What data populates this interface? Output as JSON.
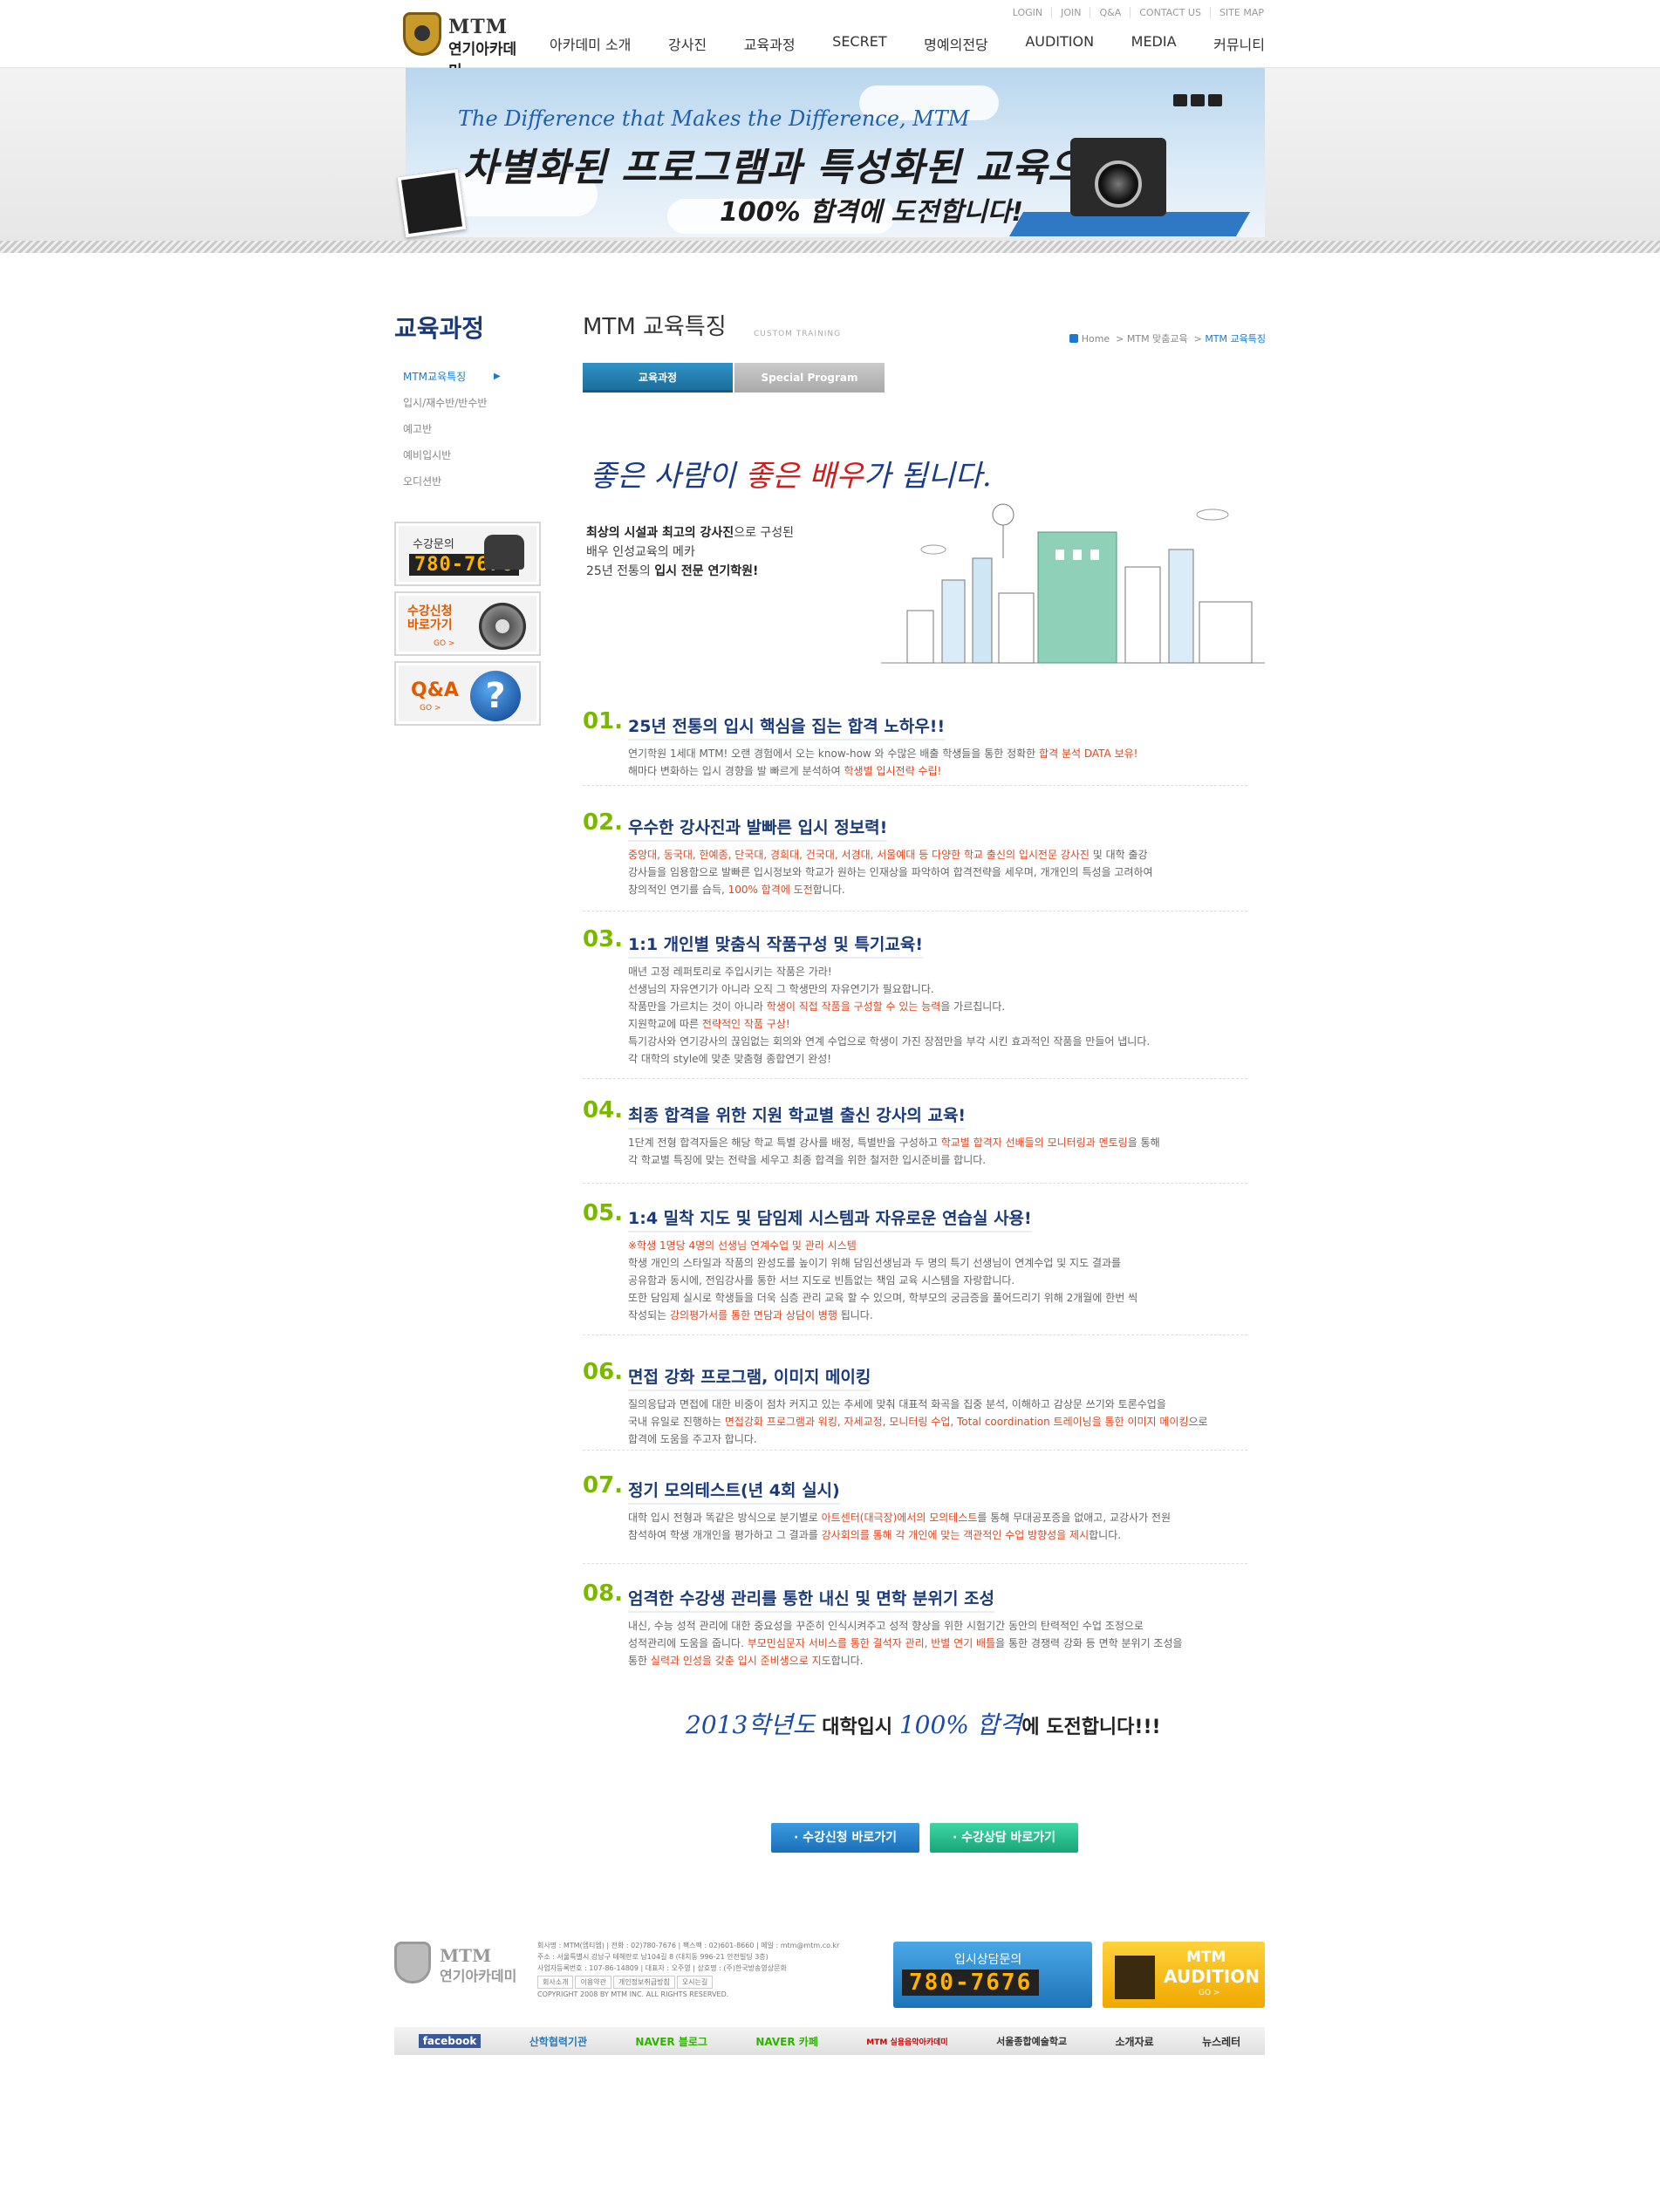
{
  "header": {
    "logo_en": "MTM",
    "logo_ko": "연기아카데미",
    "util_links": [
      "LOGIN",
      "JOIN",
      "Q&A",
      "CONTACT US",
      "SITE MAP"
    ],
    "nav": [
      "아카데미 소개",
      "강사진",
      "교육과정",
      "SECRET",
      "명예의전당",
      "AUDITION",
      "MEDIA",
      "커뮤니티"
    ]
  },
  "banner": {
    "en": "The Difference that Makes the Difference, MTM",
    "line1": "차별화된 프로그램과 특성화된 교육으로",
    "line2": "100% 합격에 도전합니다!"
  },
  "sidebar": {
    "title": "교육과정",
    "items": [
      {
        "label": "MTM교육특징",
        "active": true
      },
      {
        "label": "입시/재수반/반수반"
      },
      {
        "label": "예고반"
      },
      {
        "label": "예비입시반"
      },
      {
        "label": "오디션반"
      }
    ],
    "phone_label": "수강문의",
    "phone_number": "780-7676",
    "register_label": "수강신청 바로가기",
    "register_go": "GO >",
    "qna_label": "Q&A",
    "qna_go": "GO >"
  },
  "main": {
    "title": "MTM 교육특징",
    "subtitle": "CUSTOM TRAINING",
    "breadcrumb": [
      "Home",
      "MTM 맞춤교육",
      "MTM 교육특징"
    ],
    "tabs": [
      "교육과정",
      "Special Program"
    ],
    "slogan_a": "좋은 사람이 ",
    "slogan_b": "좋은 배우",
    "slogan_c": "가 됩니다.",
    "intro_1a": "최상의 시설과 최고의 강사진",
    "intro_1b": "으로 구성된",
    "intro_2": "배우 인성교육의 메카",
    "intro_3a": "25년 전통의 ",
    "intro_3b": "입시 전문 연기학원!",
    "sections": [
      {
        "num": "01.",
        "title": "25년 전통의 입시 핵심을 집는 합격 노하우!!",
        "lines": [
          [
            "연기학원 1세대 MTM! 오랜 경험에서 오는 know-how 와 수많은 배출 학생들을 통한 정확한 ",
            "합격 분석 DATA 보유!"
          ],
          [
            "해마다 변화하는 입시 경향을 발 빠르게 분석하여 ",
            "학생별 입시전략 수립!"
          ]
        ]
      },
      {
        "num": "02.",
        "title": "우수한 강사진과 발빠른 입시 정보력!",
        "lines": [
          [
            "",
            "중앙대, 동국대, 한예종, 단국대, 경희대, 건국대, 서경대, 서울예대 등 다양한 학교 출신의 입시전문 강사진",
            " 및 대학 출강"
          ],
          [
            "강사들을 임용함으로 발빠른 입시정보와 학교가 원하는 인재상을 파악하여 합격전략을 세우며, 개개인의 특성을 고려하여"
          ],
          [
            "창의적인 연기를 습득, ",
            "100% 합격에 도전",
            "합니다."
          ]
        ]
      },
      {
        "num": "03.",
        "title": "1:1 개인별 맞춤식 작품구성 및 특기교육!",
        "lines": [
          [
            "매년 고정 레퍼토리로 주입시키는 작품은 가라!"
          ],
          [
            "선생님의 자유연기가 아니라 오직 그 학생만의 자유연기가 필요합니다."
          ],
          [
            "작품만을 가르치는 것이 아니라 ",
            "학생이 직접 작품을 구성할 수 있는 능력",
            "을 가르칩니다."
          ],
          [
            "지원학교에 따른 ",
            "전략적인 작품 구상!"
          ],
          [
            "특기강사와 연기강사의 끊임없는 회의와 연계 수업으로 학생이 가진 장점만을 부각 시킨 효과적인 작품을 만들어 냅니다."
          ],
          [
            "각 대학의 style에 맞춘 맞춤형 종합연기 완성!"
          ]
        ]
      },
      {
        "num": "04.",
        "title": "최종 합격을 위한 지원 학교별 출신 강사의 교육!",
        "lines": [
          [
            "1단계 전형 합격자들은 해당 학교 특별 강사를 배정, 특별반을 구성하고 ",
            "학교별 합격자 선배들의 모니터링과 멘토링",
            "을 통해"
          ],
          [
            "각 학교별 특징에 맞는 전략을 세우고 최종 합격을 위한 철저한 입시준비를 합니다."
          ]
        ]
      },
      {
        "num": "05.",
        "title": "1:4 밀착 지도 및 담임제 시스템과 자유로운 연습실 사용!",
        "lines": [
          [
            "",
            "※학생 1명당 4명의 선생님 연계수업 및 관리 시스템"
          ],
          [
            "학생 개인의 스타일과 작품의 완성도를 높이기 위해 담임선생님과 두 명의 특기 선생님이 연계수업 및 지도 결과를"
          ],
          [
            "공유함과 동시에, 전임강사를 통한 서브 지도로 빈틈없는 책임 교육 시스템을 자랑합니다."
          ],
          [
            "또한 담임제 실시로 학생들을 더욱 심층 관리 교육 할 수 있으며, 학부모의 궁금증을 풀어드리기 위해 2개월에 한번 씩"
          ],
          [
            "작성되는 ",
            "강의평가서를 통한 면담과 상담이 병행",
            " 됩니다."
          ]
        ]
      },
      {
        "num": "06.",
        "title": "면접 강화 프로그램, 이미지 메이킹",
        "lines": [
          [
            "질의응답과 면접에 대한 비중이 점차 커지고 있는 추세에 맞춰 대표적 화곡을 집중 분석, 이해하고 감상문 쓰기와 토론수업을"
          ],
          [
            "국내 유일로 진행하는 ",
            "면접강화 프로그램과 워킹, 자세교정, 모니터링 수업, Total coordination 트레이닝을 통한 이미지 메이킹",
            "으로"
          ],
          [
            "합격에 도움을 주고자 합니다."
          ]
        ]
      },
      {
        "num": "07.",
        "title": "정기 모의테스트(년 4회 실시)",
        "lines": [
          [
            "대학 입시 전형과 똑같은 방식으로 분기별로 ",
            "아트센터(대극장)에서의 모의테스트",
            "를 통해 무대공포증을 없애고, 교강사가 전원"
          ],
          [
            "참석하여 학생 개개인을 평가하고 그 결과를 ",
            "강사회의를 통해 각 개인에 맞는 객관적인 수업 방향성을 제시",
            "합니다."
          ]
        ]
      },
      {
        "num": "08.",
        "title": "엄격한 수강생 관리를 통한 내신 및 면학 분위기 조성",
        "lines": [
          [
            "내신, 수능 성적 관리에 대한 중요성을 꾸준히 인식시켜주고 성적 향상을 위한 시험기간 동안의 탄력적인 수업 조정으로"
          ],
          [
            "성적관리에 도움을 줍니다. ",
            "부모민심문자 서비스를 통한 결석자 관리, 반별 연기 배틀",
            "을 통한 경쟁력 강화 등 면학 분위기 조성을"
          ],
          [
            "통한 ",
            "실력과 인성을 갖춘 입시 준비생으로 지도",
            "합니다."
          ]
        ]
      }
    ],
    "closing_blue": "2013학년도",
    "closing_mid": " 대학입시 ",
    "closing_blue2": "100% 합격",
    "closing_end": "에 도전합니다!!!",
    "button_register": "· 수강신청 바로가기",
    "button_consult": "· 수강상담 바로가기"
  },
  "footer": {
    "logo_en": "MTM",
    "logo_ko": "연기아카데미",
    "info_1": "회사명 : MTM(엠티엠) | 전화 : 02)780-7676 | 팩스팩 : 02)601-8660 | 메일 : mtm@mtm.co.kr",
    "info_2": "주소 : 서울특별시 강남구 테헤란로 남104길 8 (대치동 996-21 안전빌딩 3층)",
    "info_3": "사업자등록번호 : 107-86-14809 | 대표자 : 오주영 | 상호명 : (주)한국방송영상문화",
    "links": [
      "회사소개",
      "이용약관",
      "개인정보취급방침",
      "오시는길"
    ],
    "copyright": "COPYRIGHT 2008 BY MTM INC. ALL RIGHTS RESERVED.",
    "phone_label": "입시상담문의",
    "phone_number": "780-7676",
    "aud_1": "MTM",
    "aud_2": "AUDITION",
    "aud_3": "GO >",
    "bar": [
      "facebook",
      "산학협력기관",
      "NAVER 블로그",
      "NAVER 카페",
      "MTM 실용음악아카데미",
      "서울종합예술학교",
      "소개자료",
      "뉴스레터"
    ]
  },
  "colors": {
    "accent": "#1a3a7a",
    "highlight": "#e4451e",
    "number_green": "#7ab800",
    "tab_blue": "#2f93c7"
  }
}
